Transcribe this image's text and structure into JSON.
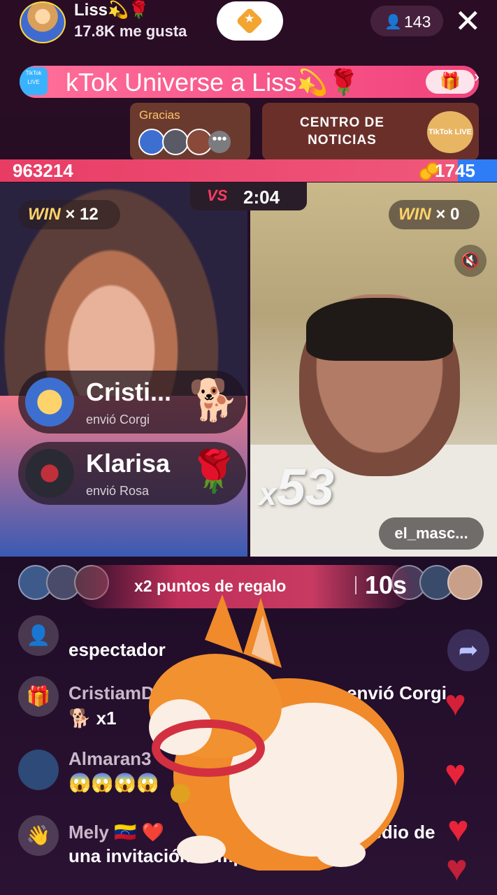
{
  "header": {
    "host_name": "Liss💫🌹",
    "host_likes": "17.8K me gusta",
    "viewer_count": "143",
    "close": "✕"
  },
  "banner": {
    "badge": "TikTok LIVE",
    "text": "kTok Universe a Liss💫🌹",
    "gift_icon": "gift-icon"
  },
  "cards": {
    "thanks_label": "Gracias",
    "more": "•••",
    "news_line1": "CENTRO DE",
    "news_line2": "NOTICIAS",
    "news_logo": "TikTok LIVE"
  },
  "battle": {
    "score_left": "963214",
    "score_right": "1745",
    "vs": "VS",
    "timer": "2:04",
    "win_label": "WIN",
    "left_wins": "× 12",
    "right_wins": "× 0",
    "opponent_name": "el_masc...",
    "combo_prefix": "x",
    "combo_value": "53"
  },
  "gift_notifications": [
    {
      "name": "Cristi...",
      "action": "envió Corgi",
      "gift": "🐕"
    },
    {
      "name": "Klarisa",
      "action": "envió Rosa",
      "gift": "🌹"
    }
  ],
  "bonus": {
    "text": "x2 puntos de regalo",
    "countdown": "10s"
  },
  "chat": [
    {
      "name": "",
      "text": "espectador"
    },
    {
      "name": "CristiamD",
      "text": "envió Corgi",
      "extra": "🐕 x1"
    },
    {
      "name": "Almaran3",
      "text": "😱😱😱😱"
    },
    {
      "name": "Mely 🇻🇪 ❤️",
      "text": "I LIVE ... medio de",
      "line2": "una invitación compartida"
    }
  ],
  "colors": {
    "accent_pink": "#f0427c",
    "score_blue": "#2f7df6",
    "heart_red": "#e8233a"
  }
}
